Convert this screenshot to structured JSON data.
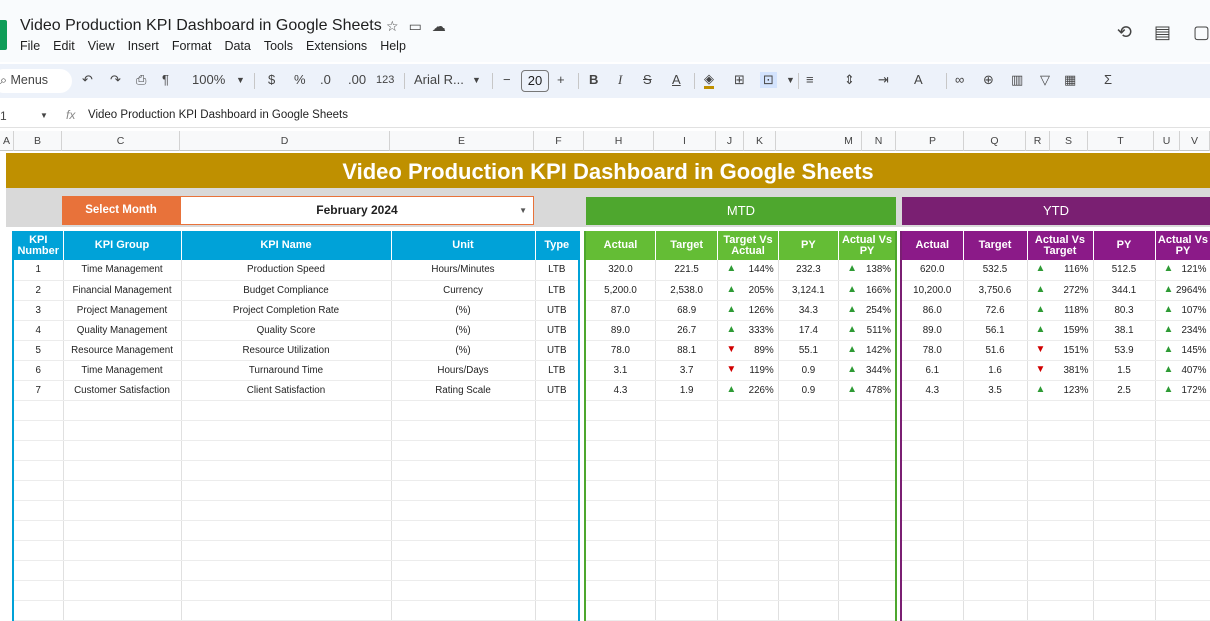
{
  "window": {
    "doc_title": "Video Production KPI Dashboard in Google Sheets",
    "menu": [
      "File",
      "Edit",
      "View",
      "Insert",
      "Format",
      "Data",
      "Tools",
      "Extensions",
      "Help"
    ]
  },
  "toolbar": {
    "menus_label": "Menus",
    "zoom": "100%",
    "currency": "$",
    "percent": "%",
    "decimal_dec": ".0",
    "number_format": "123",
    "font": "Arial R...",
    "font_size": "20",
    "bold": "B",
    "italic": "I",
    "sigma": "Σ"
  },
  "formula_bar": {
    "cell_ref": "1",
    "fx": "fx",
    "content": "Video Production KPI Dashboard in Google Sheets"
  },
  "columns": [
    "A",
    "B",
    "C",
    "D",
    "E",
    "F",
    "H",
    "I",
    "J",
    "K",
    "L",
    "M",
    "N",
    "P",
    "Q",
    "R",
    "S",
    "T",
    "U",
    "V"
  ],
  "dashboard": {
    "title": "Video Production KPI Dashboard in Google Sheets",
    "select_label": "Select Month",
    "selected_month": "February 2024",
    "mtd_label": "MTD",
    "ytd_label": "YTD",
    "left_headers": [
      "KPI Number",
      "KPI Group",
      "KPI Name",
      "Unit",
      "Type"
    ],
    "mtd_headers": [
      "Actual",
      "Target",
      "Target Vs Actual",
      "PY",
      "Actual Vs PY"
    ],
    "ytd_headers": [
      "Actual",
      "Target",
      "Actual Vs Target",
      "PY",
      "Actual Vs PY"
    ],
    "rows": [
      {
        "num": "1",
        "group": "Time Management",
        "name": "Production Speed",
        "unit": "Hours/Minutes",
        "type": "LTB",
        "mtd": {
          "actual": "320.0",
          "target": "221.5",
          "tva_dir": "up",
          "tva": "144%",
          "py": "232.3",
          "avp_dir": "up",
          "avp": "138%"
        },
        "ytd": {
          "actual": "620.0",
          "target": "532.5",
          "avt_dir": "up",
          "avt": "116%",
          "py": "512.5",
          "avp_dir": "up",
          "avp": "121%"
        }
      },
      {
        "num": "2",
        "group": "Financial Management",
        "name": "Budget Compliance",
        "unit": "Currency",
        "type": "LTB",
        "mtd": {
          "actual": "5,200.0",
          "target": "2,538.0",
          "tva_dir": "up",
          "tva": "205%",
          "py": "3,124.1",
          "avp_dir": "up",
          "avp": "166%"
        },
        "ytd": {
          "actual": "10,200.0",
          "target": "3,750.6",
          "avt_dir": "up",
          "avt": "272%",
          "py": "344.1",
          "avp_dir": "up",
          "avp": "2964%"
        }
      },
      {
        "num": "3",
        "group": "Project Management",
        "name": "Project Completion Rate",
        "unit": "(%)",
        "type": "UTB",
        "mtd": {
          "actual": "87.0",
          "target": "68.9",
          "tva_dir": "up",
          "tva": "126%",
          "py": "34.3",
          "avp_dir": "up",
          "avp": "254%"
        },
        "ytd": {
          "actual": "86.0",
          "target": "72.6",
          "avt_dir": "up",
          "avt": "118%",
          "py": "80.3",
          "avp_dir": "up",
          "avp": "107%"
        }
      },
      {
        "num": "4",
        "group": "Quality Management",
        "name": "Quality Score",
        "unit": "(%)",
        "type": "UTB",
        "mtd": {
          "actual": "89.0",
          "target": "26.7",
          "tva_dir": "up",
          "tva": "333%",
          "py": "17.4",
          "avp_dir": "up",
          "avp": "511%"
        },
        "ytd": {
          "actual": "89.0",
          "target": "56.1",
          "avt_dir": "up",
          "avt": "159%",
          "py": "38.1",
          "avp_dir": "up",
          "avp": "234%"
        }
      },
      {
        "num": "5",
        "group": "Resource Management",
        "name": "Resource Utilization",
        "unit": "(%)",
        "type": "UTB",
        "mtd": {
          "actual": "78.0",
          "target": "88.1",
          "tva_dir": "down",
          "tva": "89%",
          "py": "55.1",
          "avp_dir": "up",
          "avp": "142%"
        },
        "ytd": {
          "actual": "78.0",
          "target": "51.6",
          "avt_dir": "down",
          "avt": "151%",
          "py": "53.9",
          "avp_dir": "up",
          "avp": "145%"
        }
      },
      {
        "num": "6",
        "group": "Time Management",
        "name": "Turnaround Time",
        "unit": "Hours/Days",
        "type": "LTB",
        "mtd": {
          "actual": "3.1",
          "target": "3.7",
          "tva_dir": "down",
          "tva": "119%",
          "py": "0.9",
          "avp_dir": "up",
          "avp": "344%"
        },
        "ytd": {
          "actual": "6.1",
          "target": "1.6",
          "avt_dir": "down",
          "avt": "381%",
          "py": "1.5",
          "avp_dir": "up",
          "avp": "407%"
        }
      },
      {
        "num": "7",
        "group": "Customer Satisfaction",
        "name": "Client Satisfaction",
        "unit": "Rating Scale",
        "type": "UTB",
        "mtd": {
          "actual": "4.3",
          "target": "1.9",
          "tva_dir": "up",
          "tva": "226%",
          "py": "0.9",
          "avp_dir": "up",
          "avp": "478%"
        },
        "ytd": {
          "actual": "4.3",
          "target": "3.5",
          "avt_dir": "up",
          "avt": "123%",
          "py": "2.5",
          "avp_dir": "up",
          "avp": "172%"
        }
      }
    ],
    "empty_rows": 11
  }
}
